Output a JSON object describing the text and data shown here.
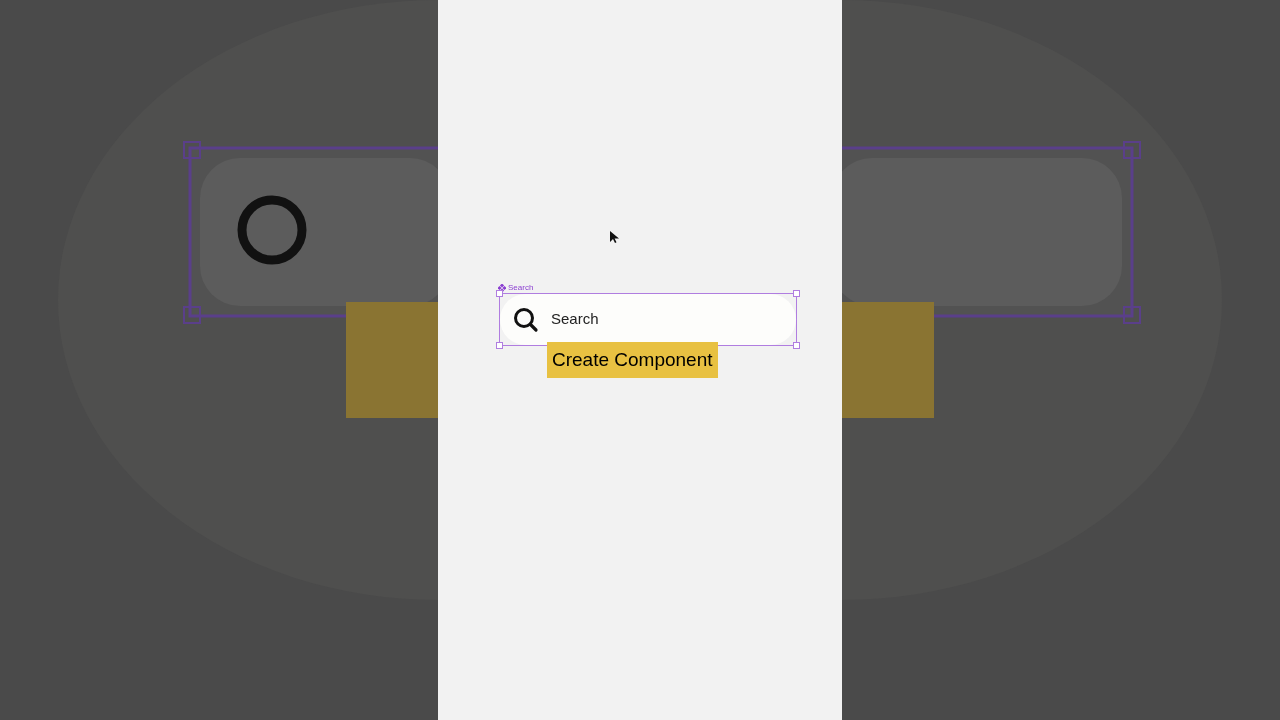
{
  "component": {
    "label": "Search",
    "selected": true,
    "text": "Search"
  },
  "caption": "Create Component"
}
